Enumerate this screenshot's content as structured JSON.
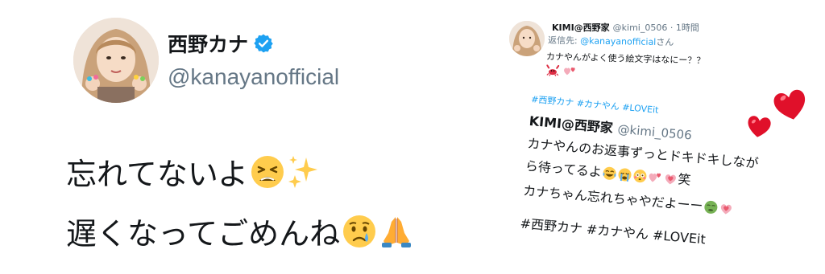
{
  "main_tweet": {
    "display_name": "西野カナ",
    "handle": "@kanayanofficial",
    "lines": [
      "忘れてないよ",
      "遅くなってごめんね"
    ]
  },
  "reply": {
    "name": "KIMI@西野家",
    "meta": "@kimi_0506 · 1時間",
    "reply_prefix": "返信先: ",
    "reply_link": "@kanayanofficial",
    "reply_suffix": "さん",
    "text": "カナやんがよく使う絵文字はなにー？？"
  },
  "quote": {
    "tags_top": "#西野カナ #カナやん #LOVEit",
    "name": "KIMI@西野家",
    "handle": "@kimi_0506",
    "line1": "カナやんのお返事ずっとドキドキしなが",
    "line2": "ら待ってるよ",
    "line2_suffix": "笑",
    "line3": "カナちゃん忘れちゃやだよーー",
    "tags_bottom": "#西野カナ #カナやん #LOVEit"
  },
  "colors": {
    "link_blue": "#1da1f2",
    "verified_blue": "#1da1f2",
    "text_dark": "#14171a",
    "text_gray": "#657786",
    "heart_red": "#e0102a"
  },
  "icons": [
    "verified-badge-icon",
    "tired-face-emoji",
    "sparkles-emoji",
    "crying-face-emoji",
    "folded-hands-emoji",
    "crab-emoji",
    "two-hearts-emoji",
    "joy-emoji",
    "sob-emoji",
    "flushed-emoji",
    "growing-heart-emoji",
    "nauseated-face-emoji",
    "red-heart-icon"
  ]
}
